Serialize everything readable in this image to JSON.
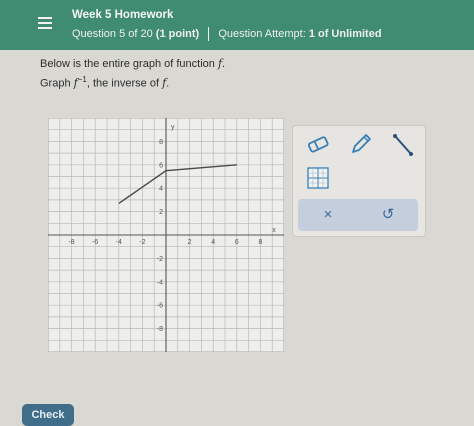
{
  "header": {
    "title": "Week 5 Homework",
    "question": "Question 5 of 20",
    "points": "(1 point)",
    "attempt_label": "Question Attempt:",
    "attempt_value": "1 of Unlimited"
  },
  "prompt": {
    "line1_text": "Below is the entire graph of function ",
    "fn": "f",
    "fn_end": ".",
    "line2_prefix": "Graph ",
    "inv_fn": "f",
    "inv_exp": "−1",
    "line2_mid": ", the inverse of ",
    "line2_end": "."
  },
  "graph": {
    "x_axis_label": "x",
    "y_axis_label": "y",
    "x_tick_labels": [
      "-8",
      "-6",
      "-4",
      "-2",
      "2",
      "4",
      "6",
      "8"
    ],
    "y_tick_labels": [
      "8",
      "6",
      "4",
      "2",
      "-2",
      "-4",
      "-6",
      "-8"
    ],
    "function_points": [
      [
        -4,
        2.7
      ],
      [
        0,
        5.5
      ],
      [
        6,
        6
      ]
    ]
  },
  "tools": {
    "eraser": "eraser-icon",
    "pencil": "pencil-icon",
    "line": "line-segment-icon",
    "grid": "grid-icon",
    "clear": "×",
    "undo": "↺"
  },
  "check_label": "Check",
  "colors": {
    "header": "#3f8c72",
    "tool_blue": "#3a7fb5",
    "check_button": "#3f6d8a"
  }
}
